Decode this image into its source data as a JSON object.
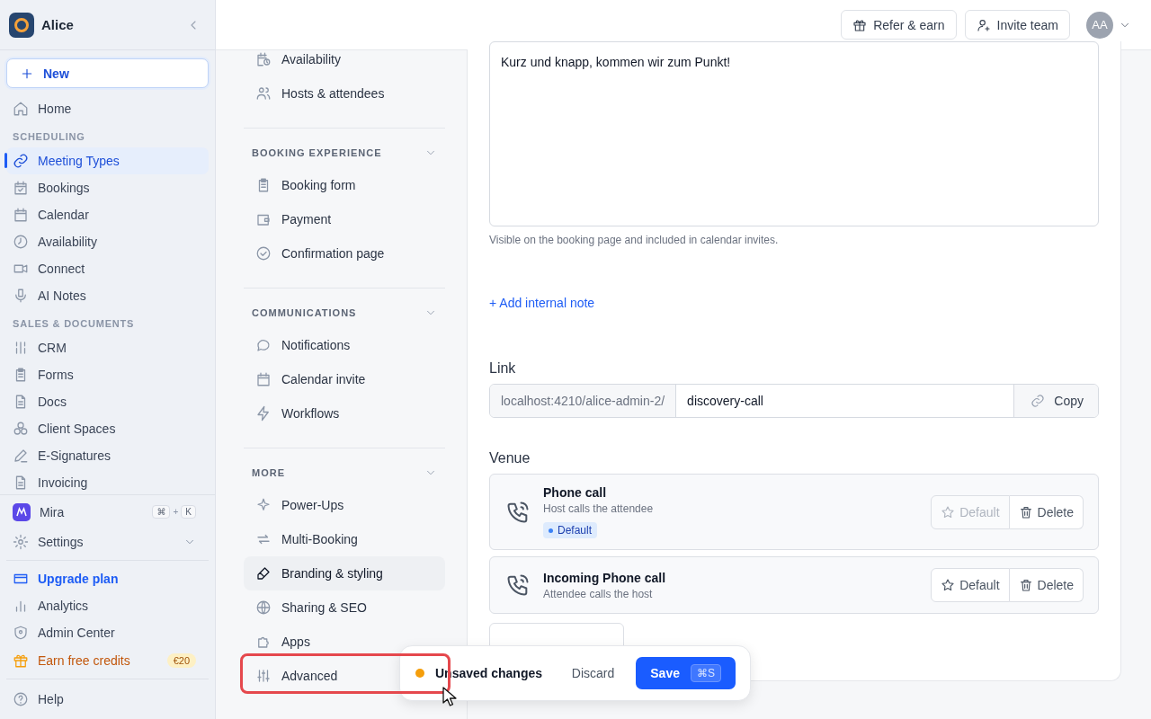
{
  "sidebar": {
    "workspace": "Alice",
    "new_button": "New",
    "nav": [
      {
        "kind": "item",
        "label": "Home",
        "selected": false
      },
      {
        "kind": "section",
        "label": "SCHEDULING"
      },
      {
        "kind": "item",
        "label": "Meeting Types",
        "selected": true
      },
      {
        "kind": "item",
        "label": "Bookings",
        "selected": false
      },
      {
        "kind": "item",
        "label": "Calendar",
        "selected": false
      },
      {
        "kind": "item",
        "label": "Availability",
        "selected": false
      },
      {
        "kind": "item",
        "label": "Connect",
        "selected": false
      },
      {
        "kind": "item",
        "label": "AI Notes",
        "selected": false
      },
      {
        "kind": "section",
        "label": "SALES & DOCUMENTS"
      },
      {
        "kind": "item",
        "label": "CRM",
        "selected": false
      },
      {
        "kind": "item",
        "label": "Forms",
        "selected": false
      },
      {
        "kind": "item",
        "label": "Docs",
        "selected": false
      },
      {
        "kind": "item",
        "label": "Client Spaces",
        "selected": false
      },
      {
        "kind": "item",
        "label": "E-Signatures",
        "selected": false
      },
      {
        "kind": "item",
        "label": "Invoicing",
        "selected": false
      }
    ],
    "mira": {
      "label": "Mira",
      "keys": [
        "⌘",
        "+",
        "K"
      ]
    },
    "settings": {
      "label": "Settings",
      "expanded": false
    },
    "links": [
      {
        "kind": "accent",
        "label": "Upgrade plan"
      },
      {
        "kind": "plain",
        "label": "Analytics"
      },
      {
        "kind": "plain",
        "label": "Admin Center"
      },
      {
        "kind": "promo",
        "label": "Earn free credits",
        "badge": "€20"
      }
    ],
    "help": "Help"
  },
  "topbar": {
    "refer": "Refer & earn",
    "invite": "Invite team",
    "avatar": "AA"
  },
  "settings_nav": [
    {
      "items": [
        {
          "label": "Availability",
          "selected": false
        },
        {
          "label": "Hosts & attendees",
          "selected": false
        }
      ]
    },
    {
      "title": "BOOKING EXPERIENCE",
      "expanded": true,
      "items": [
        {
          "label": "Booking form",
          "selected": false
        },
        {
          "label": "Payment",
          "selected": false
        },
        {
          "label": "Confirmation page",
          "selected": false
        }
      ]
    },
    {
      "title": "COMMUNICATIONS",
      "expanded": true,
      "items": [
        {
          "label": "Notifications",
          "selected": false
        },
        {
          "label": "Calendar invite",
          "selected": false
        },
        {
          "label": "Workflows",
          "selected": false
        }
      ]
    },
    {
      "title": "MORE",
      "expanded": true,
      "items": [
        {
          "label": "Power-Ups",
          "selected": false
        },
        {
          "label": "Multi-Booking",
          "selected": false
        },
        {
          "label": "Branding & styling",
          "selected": true
        },
        {
          "label": "Sharing & SEO",
          "selected": false
        },
        {
          "label": "Apps",
          "selected": false
        },
        {
          "label": "Advanced",
          "selected": false
        }
      ]
    }
  ],
  "content": {
    "description": "Kurz und knapp, kommen wir zum Punkt!",
    "description_help": "Visible on the booking page and included in calendar invites.",
    "add_note": "+ Add internal note",
    "link": {
      "label": "Link",
      "prefix": "localhost:4210/alice-admin-2/",
      "slug": "discovery-call",
      "copy": "Copy"
    },
    "venue": {
      "label": "Venue",
      "items": [
        {
          "name": "Phone call",
          "description": "Host calls the attendee",
          "default": true,
          "badge": "Default",
          "actions": [
            "Default",
            "Delete"
          ]
        },
        {
          "name": "Incoming Phone call",
          "description": "Attendee calls the host",
          "default": false,
          "actions": [
            "Default",
            "Delete"
          ]
        }
      ]
    }
  },
  "toast": {
    "status": "Unsaved changes",
    "discard": "Discard",
    "save": "Save",
    "shortcut": "⌘S"
  }
}
